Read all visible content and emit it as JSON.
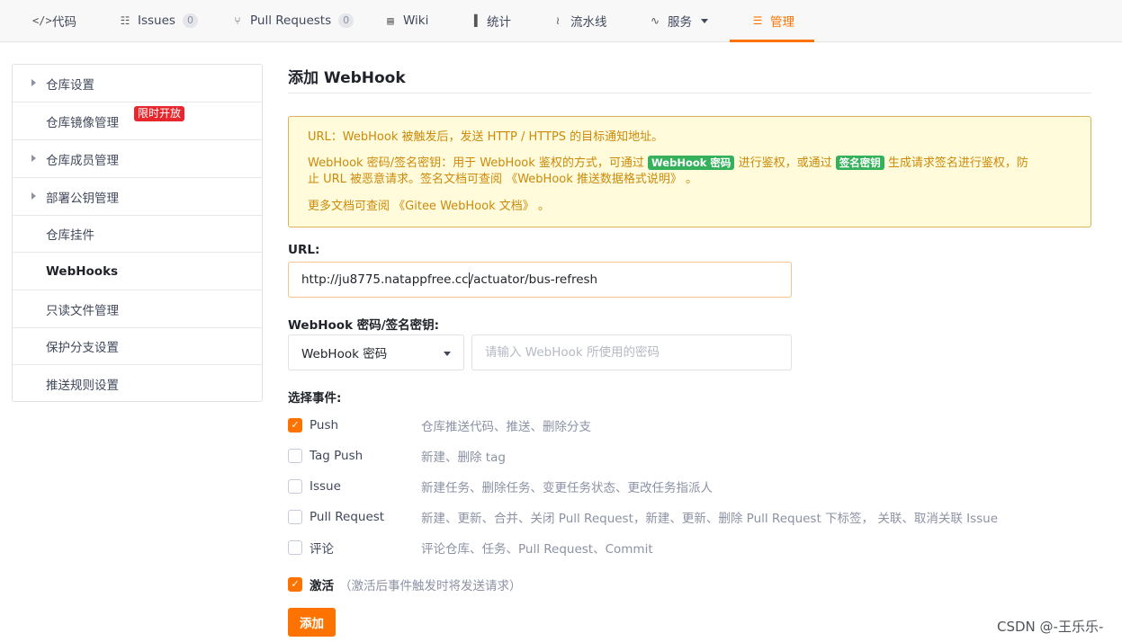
{
  "tabs": [
    {
      "icon": "code-icon",
      "glyph": "</>",
      "label": "代码"
    },
    {
      "icon": "issues-icon",
      "glyph": "☷",
      "label": "Issues",
      "count": "0"
    },
    {
      "icon": "pull-request-icon",
      "glyph": "⑂",
      "label": "Pull Requests",
      "count": "0"
    },
    {
      "icon": "wiki-icon",
      "glyph": "▤",
      "label": "Wiki"
    },
    {
      "icon": "stats-icon",
      "glyph": "▐",
      "label": "统计"
    },
    {
      "icon": "pipeline-icon",
      "glyph": "≀",
      "label": "流水线"
    },
    {
      "icon": "services-icon",
      "glyph": "∿",
      "label": "服务"
    },
    {
      "icon": "manage-icon",
      "glyph": "☰",
      "label": "管理"
    }
  ],
  "accent_color": "#fe7300",
  "sidebar": {
    "items": [
      {
        "label": "仓库设置",
        "expandable": true
      },
      {
        "label": "仓库镜像管理",
        "badge": "限时开放"
      },
      {
        "label": "仓库成员管理",
        "expandable": true
      },
      {
        "label": "部署公钥管理",
        "expandable": true
      },
      {
        "label": "仓库挂件"
      },
      {
        "label": "WebHooks",
        "active": true
      },
      {
        "label": "只读文件管理"
      },
      {
        "label": "保护分支设置"
      },
      {
        "label": "推送规则设置"
      }
    ]
  },
  "main": {
    "title": "添加 WebHook",
    "notice": {
      "line1": "URL：WebHook 被触发后，发送 HTTP / HTTPS 的目标通知地址。",
      "line2_a": "WebHook 密码/签名密钥：用于 WebHook 鉴权的方式，可通过",
      "tag_password": "WebHook 密码",
      "line2_b": "进行鉴权，或通过",
      "tag_signature": "签名密钥",
      "line2_c": "生成请求签名进行鉴权，防",
      "line3_a": "止 URL 被恶意请求。签名文档可查阅",
      "link_signature_doc": "《WebHook 推送数据格式说明》",
      "line3_b": "。",
      "line4_a": "更多文档可查阅",
      "link_gitee_doc": "《Gitee WebHook 文档》",
      "line4_b": "。"
    },
    "url_label": "URL:",
    "url_value_a": "http://ju8775.natappfree.cc",
    "url_value_b": "/actuator/bus-refresh",
    "secret_label": "WebHook 密码/签名密钥:",
    "secret_type": "WebHook 密码",
    "secret_placeholder": "请输入 WebHook 所使用的密码",
    "events_label": "选择事件:",
    "events": [
      {
        "name": "Push",
        "desc": "仓库推送代码、推送、删除分支",
        "checked": true
      },
      {
        "name": "Tag Push",
        "desc": "新建、删除 tag",
        "checked": false
      },
      {
        "name": "Issue",
        "desc": "新建任务、删除任务、变更任务状态、更改任务指派人",
        "checked": false
      },
      {
        "name": "Pull Request",
        "desc": "新建、更新、合并、关闭 Pull Request，新建、更新、删除 Pull Request 下标签， 关联、取消关联 Issue",
        "checked": false
      },
      {
        "name": "评论",
        "desc": "评论仓库、任务、Pull Request、Commit",
        "checked": false
      }
    ],
    "activate_label": "激活",
    "activate_hint": "（激活后事件触发时将发送请求）",
    "activate_checked": true,
    "add_button": "添加"
  },
  "watermark": "CSDN @-王乐乐-"
}
